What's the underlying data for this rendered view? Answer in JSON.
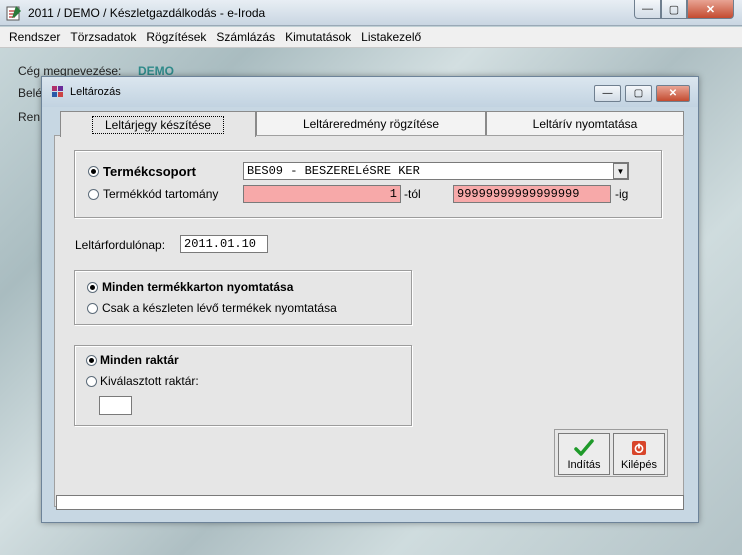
{
  "app": {
    "title": "2011 / DEMO / Készletgazdálkodás - e-Iroda",
    "controls": {
      "minimize": "—",
      "maximize": "▢",
      "close": "✕"
    }
  },
  "menu": [
    "Rendszer",
    "Törzsadatok",
    "Rögzítések",
    "Számlázás",
    "Kimutatások",
    "Listakezelő"
  ],
  "background": {
    "company_label": "Cég megnevezése:",
    "company_value": "DEMO",
    "line2": "Belé",
    "line3": "Ren"
  },
  "dialog": {
    "title": "Leltározás",
    "controls": {
      "minimize": "—",
      "maximize": "▢",
      "close": "✕"
    },
    "tabs": [
      {
        "label": "Leltárjegy készítése",
        "active": true
      },
      {
        "label": "Leltáreredmény rögzítése",
        "active": false
      },
      {
        "label": "Leltárív nyomtatása",
        "active": false
      }
    ],
    "product_filter": {
      "group_label": "Termékcsoport",
      "group_value": "BES09 - BESZERELéSRE KER",
      "range_label": "Termékkód tartomány",
      "range_from": "1",
      "from_suffix": "-tól",
      "range_to": "99999999999999999",
      "to_suffix": "-ig"
    },
    "turn_date": {
      "label": "Leltárfordulónap:",
      "value": "2011.01.10"
    },
    "print_options": {
      "all": "Minden termékkarton nyomtatása",
      "in_stock": "Csak a készleten lévő termékek nyomtatása"
    },
    "warehouse": {
      "all": "Minden raktár",
      "selected": "Kiválasztott raktár:",
      "selected_value": ""
    },
    "buttons": {
      "start": "Indítás",
      "exit": "Kilépés"
    }
  },
  "colors": {
    "accent_green": "#1f9a2a",
    "exit_red": "#d8452a",
    "invalid_field": "#f7a9a9"
  }
}
